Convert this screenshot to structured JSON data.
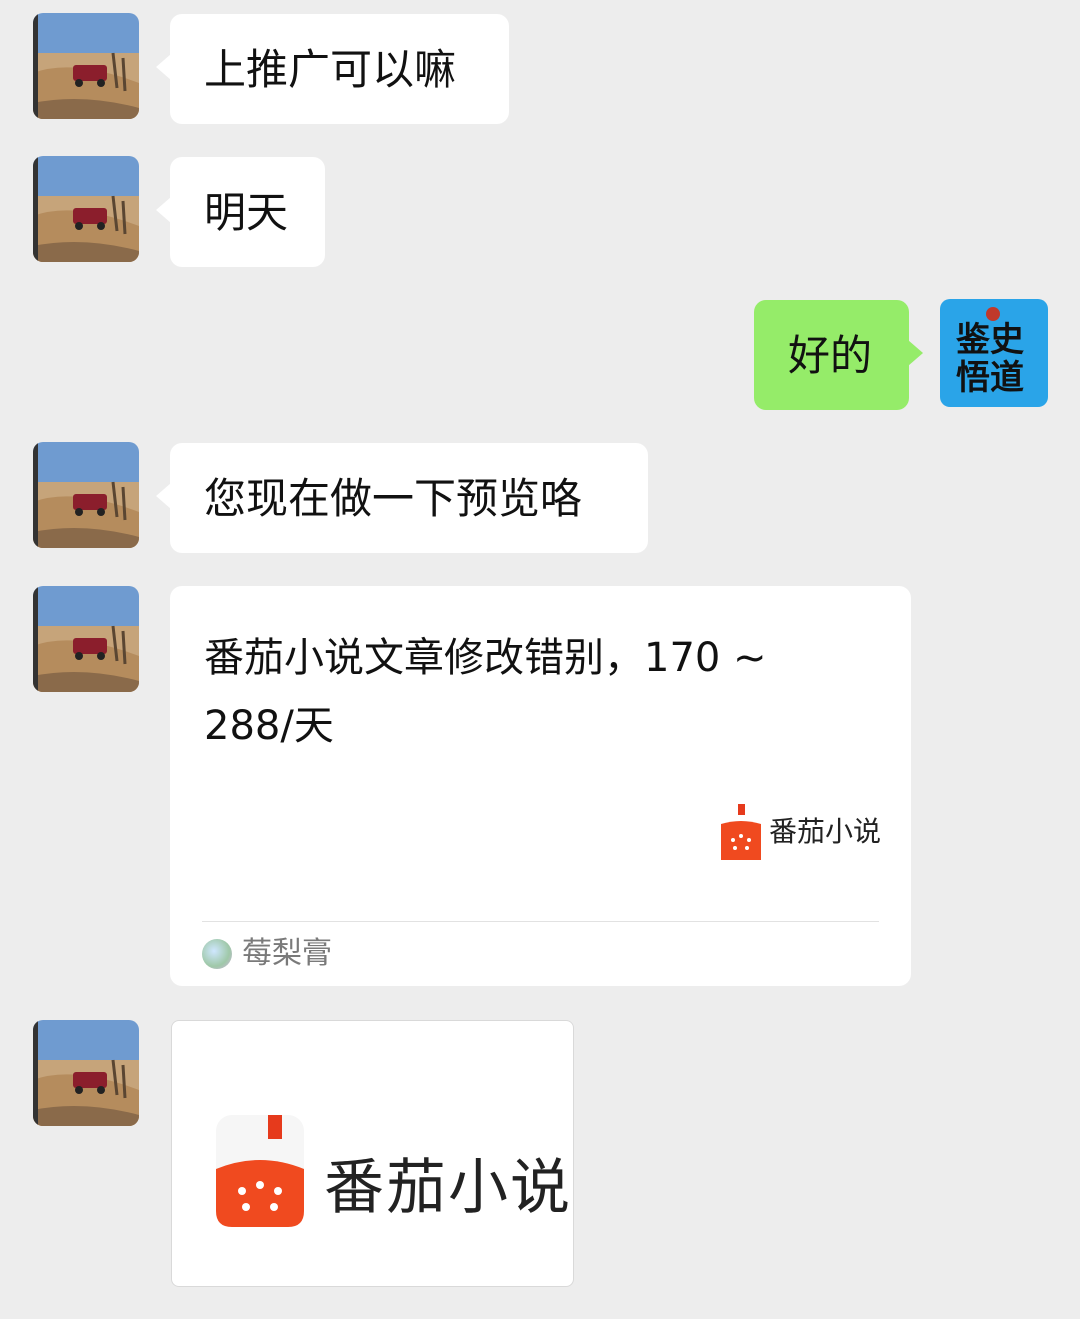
{
  "messages": [
    {
      "side": "left",
      "text": "上推广可以嘛"
    },
    {
      "side": "left",
      "text": "明天"
    },
    {
      "side": "right",
      "text": "好的"
    },
    {
      "side": "left",
      "text": "您现在做一下预览咯"
    },
    {
      "side": "left",
      "type": "link_card",
      "title": "番茄小说文章修改错别，170 ~ 288/天",
      "thumbnail_label": "番茄小说",
      "source": "莓梨膏"
    },
    {
      "side": "left",
      "type": "image",
      "brand": "番茄小说"
    }
  ],
  "self_avatar": {
    "line1": "鉴史",
    "line2": "悟道"
  },
  "colors": {
    "background": "#ededed",
    "bubble_self": "#95ec69",
    "bubble_other": "#ffffff",
    "tomato": "#f04a1f"
  }
}
